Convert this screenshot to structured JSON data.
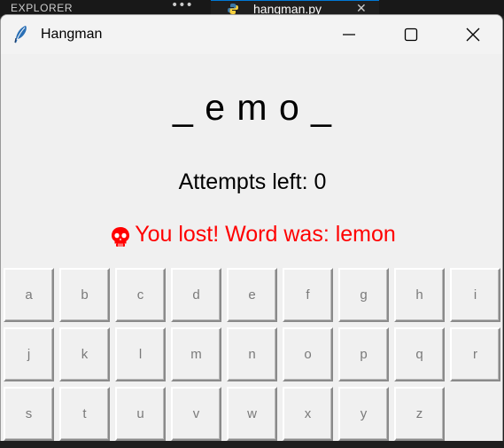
{
  "background": {
    "explorer_label": "EXPLORER",
    "dots": "•••",
    "tab_label": "hangman.py",
    "tab_close": "✕"
  },
  "window": {
    "title": "Hangman",
    "icon": "feather-icon",
    "controls": {
      "minimize": "minimize-icon",
      "maximize": "maximize-icon",
      "close": "close-icon"
    }
  },
  "game": {
    "word_display": "_ e m o _",
    "attempts_text": "Attempts left: 0",
    "status_icon": "skull-icon",
    "status_text": "You lost! Word was: lemon"
  },
  "keyboard": {
    "rows": [
      [
        "a",
        "b",
        "c",
        "d",
        "e",
        "f",
        "g",
        "h",
        "i"
      ],
      [
        "j",
        "k",
        "l",
        "m",
        "n",
        "o",
        "p",
        "q",
        "r"
      ],
      [
        "s",
        "t",
        "u",
        "v",
        "w",
        "x",
        "y",
        "z"
      ]
    ],
    "disabled": true
  },
  "colors": {
    "window_bg": "#f0f0f0",
    "status_color": "#ff0000",
    "key_text_disabled": "#7a7a7a"
  }
}
